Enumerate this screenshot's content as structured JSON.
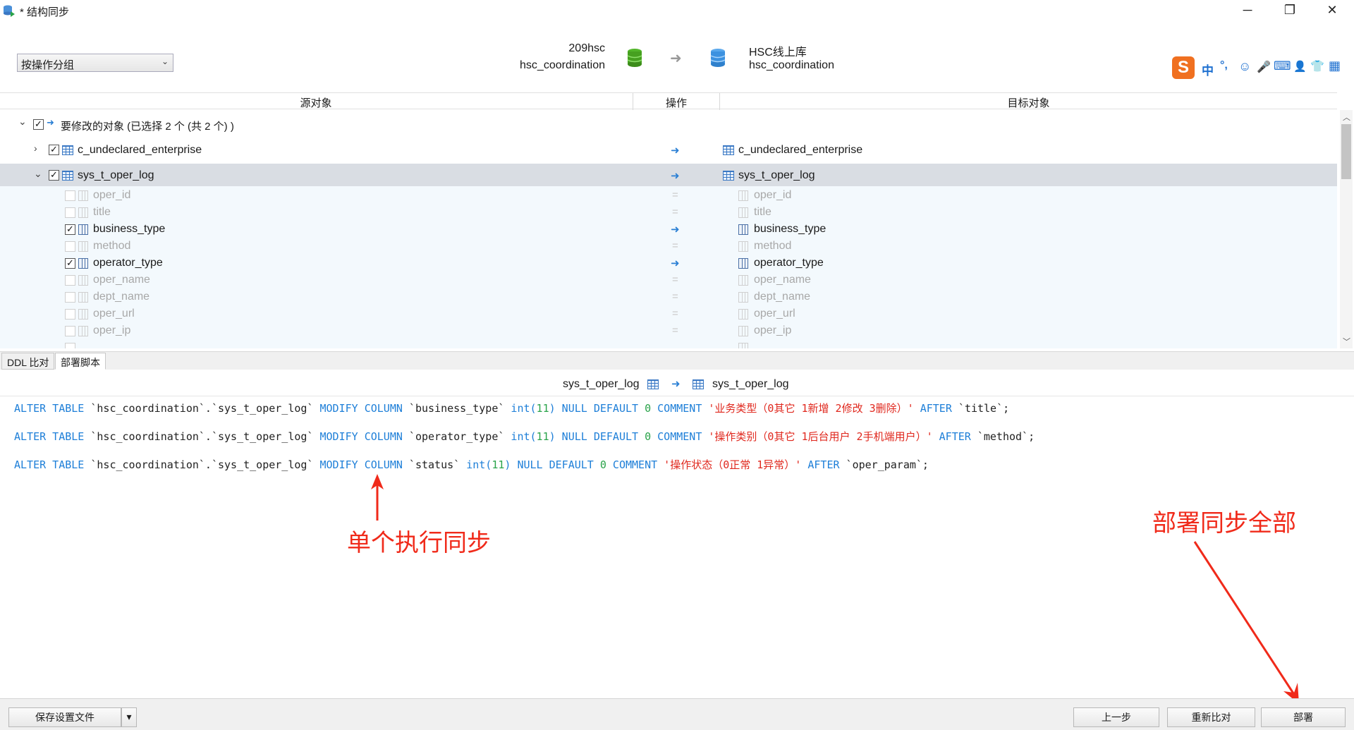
{
  "window": {
    "title": "* 结构同步",
    "minimize": "─",
    "restore": "❐",
    "close": "✕"
  },
  "header": {
    "group_select": {
      "value": "按操作分组"
    },
    "source": {
      "server": "209hsc",
      "database": "hsc_coordination"
    },
    "target": {
      "server": "HSC线上库",
      "database": "hsc_coordination"
    }
  },
  "ime_bar": {
    "items": [
      "中",
      "°,",
      "☺",
      "🎤",
      "⌨",
      "👤",
      "👕",
      "▦"
    ]
  },
  "columns": {
    "source": "源对象",
    "operation": "操作",
    "target": "目标对象"
  },
  "tree": {
    "group_label": "要修改的对象 (已选择 2 个 (共 2 个) )",
    "tables": [
      {
        "name": "c_undeclared_enterprise",
        "target": "c_undeclared_enterprise",
        "checked": true,
        "expanded": false
      },
      {
        "name": "sys_t_oper_log",
        "target": "sys_t_oper_log",
        "checked": true,
        "expanded": true
      }
    ],
    "fields": [
      {
        "name": "oper_id",
        "checked": false,
        "changed": false
      },
      {
        "name": "title",
        "checked": false,
        "changed": false
      },
      {
        "name": "business_type",
        "checked": true,
        "changed": true
      },
      {
        "name": "method",
        "checked": false,
        "changed": false
      },
      {
        "name": "operator_type",
        "checked": true,
        "changed": true
      },
      {
        "name": "oper_name",
        "checked": false,
        "changed": false
      },
      {
        "name": "dept_name",
        "checked": false,
        "changed": false
      },
      {
        "name": "oper_url",
        "checked": false,
        "changed": false
      },
      {
        "name": "oper_ip",
        "checked": false,
        "changed": false
      }
    ]
  },
  "tabs": [
    {
      "label": "DDL 比对",
      "active": false
    },
    {
      "label": "部署脚本",
      "active": true
    }
  ],
  "script": {
    "source_table": "sys_t_oper_log",
    "target_table": "sys_t_oper_log",
    "lines": [
      [
        {
          "t": "ALTER TABLE",
          "c": "kw"
        },
        {
          "t": " `hsc_coordination`.`sys_t_oper_log` ",
          "c": "plain"
        },
        {
          "t": "MODIFY COLUMN",
          "c": "kw"
        },
        {
          "t": " `business_type` ",
          "c": "plain"
        },
        {
          "t": "int(",
          "c": "kw"
        },
        {
          "t": "11",
          "c": "num"
        },
        {
          "t": ")",
          "c": "kw"
        },
        {
          "t": " NULL DEFAULT ",
          "c": "kw"
        },
        {
          "t": "0",
          "c": "num"
        },
        {
          "t": " COMMENT ",
          "c": "kw"
        },
        {
          "t": "'业务类型（0其它 1新增 2修改 3删除）'",
          "c": "str"
        },
        {
          "t": " AFTER ",
          "c": "kw"
        },
        {
          "t": "`title`;",
          "c": "plain"
        }
      ],
      [
        {
          "t": "ALTER TABLE",
          "c": "kw"
        },
        {
          "t": " `hsc_coordination`.`sys_t_oper_log` ",
          "c": "plain"
        },
        {
          "t": "MODIFY COLUMN",
          "c": "kw"
        },
        {
          "t": " `operator_type` ",
          "c": "plain"
        },
        {
          "t": "int(",
          "c": "kw"
        },
        {
          "t": "11",
          "c": "num"
        },
        {
          "t": ")",
          "c": "kw"
        },
        {
          "t": " NULL DEFAULT ",
          "c": "kw"
        },
        {
          "t": "0",
          "c": "num"
        },
        {
          "t": " COMMENT ",
          "c": "kw"
        },
        {
          "t": "'操作类别（0其它 1后台用户 2手机端用户）'",
          "c": "str"
        },
        {
          "t": " AFTER ",
          "c": "kw"
        },
        {
          "t": "`method`;",
          "c": "plain"
        }
      ],
      [
        {
          "t": "ALTER TABLE",
          "c": "kw"
        },
        {
          "t": " `hsc_coordination`.`sys_t_oper_log` ",
          "c": "plain"
        },
        {
          "t": "MODIFY COLUMN",
          "c": "kw"
        },
        {
          "t": " `status` ",
          "c": "plain"
        },
        {
          "t": "int(",
          "c": "kw"
        },
        {
          "t": "11",
          "c": "num"
        },
        {
          "t": ")",
          "c": "kw"
        },
        {
          "t": " NULL DEFAULT ",
          "c": "kw"
        },
        {
          "t": "0",
          "c": "num"
        },
        {
          "t": " COMMENT ",
          "c": "kw"
        },
        {
          "t": "'操作状态（0正常 1异常）'",
          "c": "str"
        },
        {
          "t": " AFTER ",
          "c": "kw"
        },
        {
          "t": "`oper_param`;",
          "c": "plain"
        }
      ]
    ]
  },
  "annotations": {
    "single": "单个执行同步",
    "all": "部署同步全部"
  },
  "footer": {
    "save_settings": "保存设置文件",
    "prev": "上一步",
    "recompare": "重新比对",
    "deploy": "部署"
  },
  "colors": {
    "keyword": "#1e7fd8",
    "number": "#2aa34a",
    "string": "#e0281e",
    "annotation": "#f02a1a",
    "selected_row": "#d9dde3"
  }
}
